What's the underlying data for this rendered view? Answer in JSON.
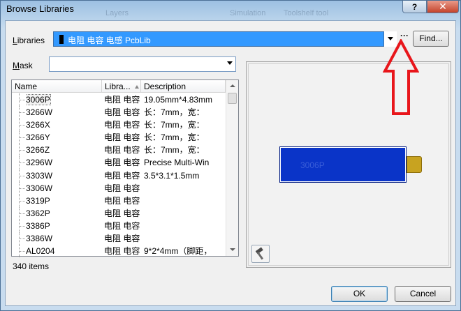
{
  "window": {
    "title": "Browse Libraries",
    "help_label": "?",
    "close_label": "✕",
    "ghost_texts": [
      "Layers",
      "Simulation",
      "Toolshelf tool"
    ]
  },
  "libraries": {
    "label_u": "L",
    "label_rest": "ibraries",
    "selected": "电阻 电容 电感 PcbLib",
    "browse_label": "···",
    "find_label": "Find..."
  },
  "mask": {
    "label_u": "M",
    "label_rest": "ask",
    "value": ""
  },
  "table": {
    "columns": [
      "Name",
      "Libra...",
      "Description"
    ],
    "rows": [
      {
        "name": "3006P",
        "library": "电阻 电容",
        "description": "19.05mm*4.83mm"
      },
      {
        "name": "3266W",
        "library": "电阻 电容",
        "description": "长：7mm，宽："
      },
      {
        "name": "3266X",
        "library": "电阻 电容",
        "description": "长：7mm，宽："
      },
      {
        "name": "3266Y",
        "library": "电阻 电容",
        "description": "长：7mm，宽："
      },
      {
        "name": "3266Z",
        "library": "电阻 电容",
        "description": "长：7mm，宽："
      },
      {
        "name": "3296W",
        "library": "电阻 电容",
        "description": "Precise Multi-Win"
      },
      {
        "name": "3303W",
        "library": "电阻 电容",
        "description": "3.5*3.1*1.5mm"
      },
      {
        "name": "3306W",
        "library": "电阻 电容",
        "description": ""
      },
      {
        "name": "3319P",
        "library": "电阻 电容",
        "description": ""
      },
      {
        "name": "3362P",
        "library": "电阻 电容",
        "description": ""
      },
      {
        "name": "3386P",
        "library": "电阻 电容",
        "description": ""
      },
      {
        "name": "3386W",
        "library": "电阻 电容",
        "description": ""
      },
      {
        "name": "AL0204",
        "library": "电阻 电容",
        "description": "9*2*4mm（脚距，"
      }
    ],
    "count_text": "340 items"
  },
  "preview": {
    "footprint_label": "3006P",
    "body_color": "#0a34c8",
    "pin_color": "#c8a320"
  },
  "annotation": {
    "arrow_color": "#e8161b"
  },
  "buttons": {
    "ok": "OK",
    "cancel": "Cancel"
  }
}
